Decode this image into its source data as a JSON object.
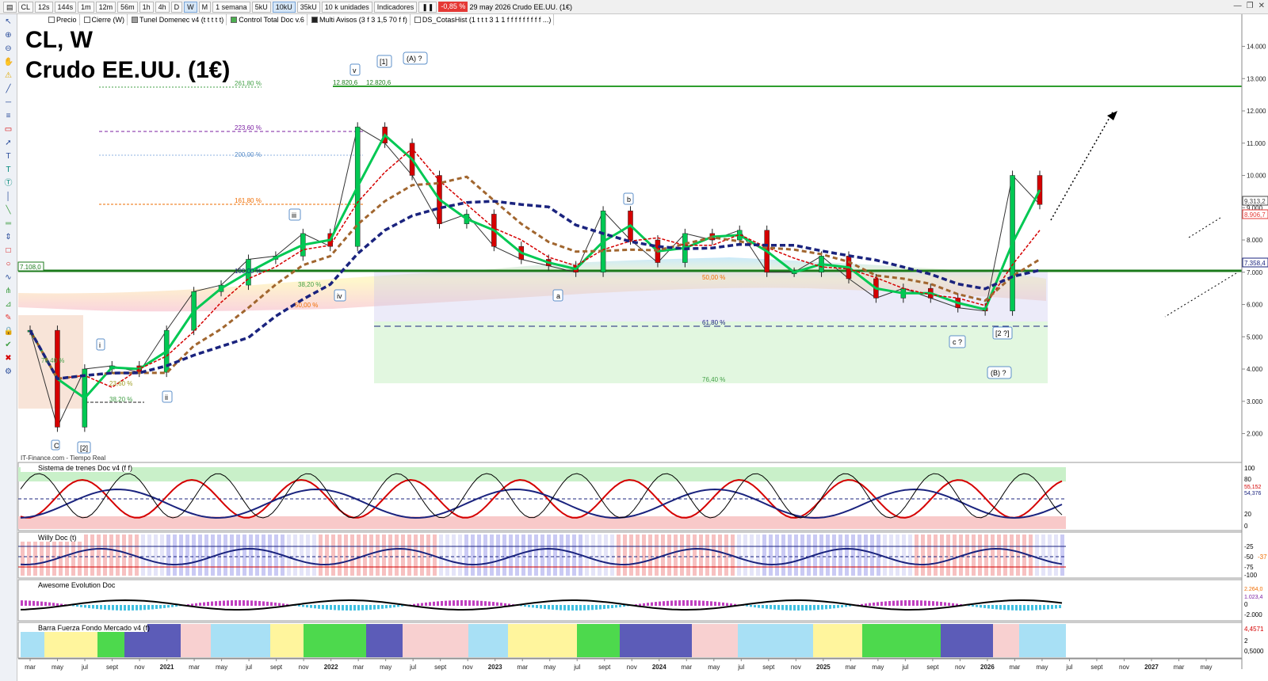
{
  "toolbar": {
    "symbol": "CL",
    "timeframes": [
      "12s",
      "144s",
      "1m",
      "12m",
      "56m",
      "1h",
      "4h",
      "D",
      "W",
      "M"
    ],
    "active_timeframe": "W",
    "period": "1 semana",
    "units": [
      "5kU",
      "10kU",
      "35kU"
    ],
    "units_label": "10 k unidades",
    "indicators_label": "Indicadores",
    "change": "-0,85 %",
    "date": "29 may 2026",
    "instrument": "Crudo EE.UU. (1€)",
    "indicator_chips": [
      {
        "label": "Precio",
        "color": "#ffffff"
      },
      {
        "label": "Cierre (W)",
        "color": "#ffffff"
      },
      {
        "label": "Tunel Domenec v4 (t t t t t)",
        "color": "#9e9e9e"
      },
      {
        "label": "Control Total Doc v.6",
        "color": "#4caf50"
      },
      {
        "label": "Multi Avisos (3 f 3 1,5 70 f f)",
        "color": "#212121"
      },
      {
        "label": "DS_CotasHist (1 t t t 3 1 1 f f f f f f f f f ...)",
        "color": "#ffffff"
      }
    ]
  },
  "main": {
    "title_line1": "CL, W",
    "title_line2": "Crudo EE.UU. (1€)",
    "watermark": "IT-Finance.com - Tiempo Real",
    "price_ticks": [
      "14.000",
      "13.000",
      "12.000",
      "11.000",
      "10.000",
      "9.000",
      "8.000",
      "7.000",
      "6.000",
      "5.000",
      "4.000",
      "3.000",
      "2.000"
    ],
    "price_tags": [
      {
        "label": "9.313,2",
        "color": "#444444"
      },
      {
        "label": "8.906,7",
        "color": "#e53935"
      },
      {
        "label": "7.358,4",
        "color": "#1a237e"
      }
    ],
    "left_tag": "7.108,0",
    "peak_labels": [
      "12.820,6",
      "12.820,6"
    ],
    "fib_labels": [
      {
        "label": "261,80 %",
        "color": "#43a047"
      },
      {
        "label": "223,60 %",
        "color": "#7b1fa2"
      },
      {
        "label": "200,00 %",
        "color": "#5c8fc9"
      },
      {
        "label": "161,80 %",
        "color": "#ef6c00"
      },
      {
        "label": "50,00 %",
        "color": "#ef6c00"
      },
      {
        "label": "61,80 %",
        "color": "#1a237e"
      },
      {
        "label": "76,40 %",
        "color": "#43a047"
      },
      {
        "label": "38,20 %",
        "color": "#43a047"
      },
      {
        "label": "23,60 %",
        "color": "#9e9d24"
      },
      {
        "label": "76,40 %",
        "color": "#43a047"
      },
      {
        "label": "50,00 %",
        "color": "#ef6c00"
      },
      {
        "label": "38,20 %",
        "color": "#43a047"
      },
      {
        "label": "100,00 %",
        "color": "#1a237e"
      }
    ],
    "wave_labels": [
      "C",
      "[2]",
      "i",
      "ii",
      "iii",
      "iv",
      "v",
      "[1]",
      "(A) ?",
      "a",
      "b",
      "c ?",
      "[2 ?]",
      "(B) ?"
    ]
  },
  "panels": [
    {
      "title": "Sistema de trenes Doc v4 (f f)",
      "ticks": [
        "100",
        "80",
        "54,376",
        "55,152",
        "20",
        "0"
      ]
    },
    {
      "title": "Willy Doc (t)",
      "ticks": [
        "-25",
        "-50",
        "-75",
        "-100",
        "-37"
      ]
    },
    {
      "title": "Awesome Evolution Doc",
      "ticks": [
        "2.264,0",
        "1.023,4",
        "0",
        "-2.000"
      ]
    },
    {
      "title": "Barra Fuerza Fondo Mercado v4 (f)",
      "ticks": [
        "4,4571",
        "2",
        "0,5000"
      ]
    }
  ],
  "time_axis": [
    "mar",
    "may",
    "jul",
    "sept",
    "nov",
    "2021",
    "mar",
    "may",
    "jul",
    "sept",
    "nov",
    "2022",
    "mar",
    "may",
    "jul",
    "sept",
    "nov",
    "2023",
    "mar",
    "may",
    "jul",
    "sept",
    "nov",
    "2024",
    "mar",
    "may",
    "jul",
    "sept",
    "nov",
    "2025",
    "mar",
    "may",
    "jul",
    "sept",
    "nov",
    "2026",
    "mar",
    "may",
    "jul",
    "sept",
    "nov",
    "2027",
    "mar",
    "may"
  ],
  "colors": {
    "bull": "#00c853",
    "bear": "#d50000",
    "resistance": "#2e9e2e",
    "support": "#1b7a1b",
    "trend_blue": "#1a237e",
    "trend_brown": "#a1662f"
  },
  "chart_data": {
    "type": "line",
    "title": "",
    "x_label": "",
    "y_label": "",
    "x": [
      "2020-03",
      "2020-05",
      "2020-07",
      "2020-09",
      "2020-11",
      "2021-01",
      "2021-03",
      "2021-05",
      "2021-07",
      "2021-09",
      "2021-11",
      "2022-01",
      "2022-03",
      "2022-05",
      "2022-07",
      "2022-09",
      "2022-11",
      "2023-01",
      "2023-03",
      "2023-05",
      "2023-07",
      "2023-09",
      "2023-11",
      "2024-01",
      "2024-03",
      "2024-05",
      "2024-07",
      "2024-09",
      "2024-11",
      "2025-01",
      "2025-03",
      "2025-05",
      "2025-07",
      "2025-09",
      "2025-11",
      "2026-01",
      "2026-03",
      "2026-05"
    ],
    "series": [
      {
        "values": [
          5.2,
          2.2,
          4.0,
          4.1,
          3.9,
          5.2,
          6.4,
          6.6,
          7.4,
          7.5,
          8.2,
          7.8,
          11.5,
          11.0,
          10.0,
          8.5,
          8.8,
          7.8,
          7.4,
          7.2,
          7.0,
          8.9,
          8.0,
          7.3,
          8.2,
          8.0,
          8.3,
          7.0,
          7.0,
          7.5,
          6.8,
          6.2,
          6.5,
          6.2,
          5.9,
          5.8,
          10.0,
          9.1
        ]
      }
    ],
    "ylim": [
      1.4,
      14.7
    ],
    "levels": [
      12.82,
      7.108
    ],
    "log_scale": false,
    "grid": false
  }
}
